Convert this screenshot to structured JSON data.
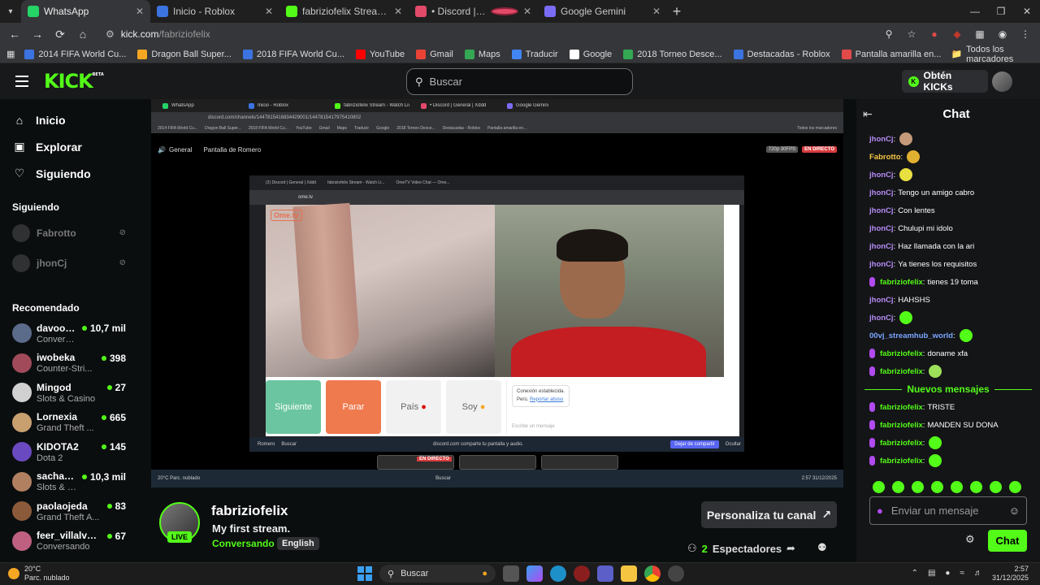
{
  "browser": {
    "tabs": [
      {
        "title": "WhatsApp",
        "fav_color": "#25d366",
        "active": true
      },
      {
        "title": "Inicio - Roblox",
        "fav_color": "#3b73e0",
        "active": false
      },
      {
        "title": "fabriziofelix Stream - Watch Live",
        "fav_color": "#53fc18",
        "active": false
      },
      {
        "title": "• Discord | General | Xddd",
        "fav_color": "#e24a6a",
        "active": false
      },
      {
        "title": "Google Gemini",
        "fav_color": "#7b6cf6",
        "active": false
      }
    ],
    "url_host": "kick.com",
    "url_path": "/fabriziofelix",
    "bookmarks": [
      {
        "label": "2014 FIFA World Cu...",
        "color": "#3b73e0"
      },
      {
        "label": "Dragon Ball Super...",
        "color": "#f5a623"
      },
      {
        "label": "2018 FIFA World Cu...",
        "color": "#3b73e0"
      },
      {
        "label": "YouTube",
        "color": "#ff0000"
      },
      {
        "label": "Gmail",
        "color": "#ea4335"
      },
      {
        "label": "Maps",
        "color": "#34a853"
      },
      {
        "label": "Traducir",
        "color": "#4285f4"
      },
      {
        "label": "Google",
        "color": "#ffffff"
      },
      {
        "label": "2018 Torneo Desce...",
        "color": "#34a853"
      },
      {
        "label": "Destacadas - Roblox",
        "color": "#3b73e0"
      },
      {
        "label": "Pantalla amarilla en...",
        "color": "#e24a4a"
      }
    ],
    "all_bookmarks": "Todos los marcadores"
  },
  "kick": {
    "logo": "KICK",
    "logo_badge": "BETA",
    "search_placeholder": "Buscar",
    "get_kicks": "Obtén KICKs",
    "nav": [
      {
        "label": "Inicio",
        "icon": "home-icon"
      },
      {
        "label": "Explorar",
        "icon": "compass-icon"
      },
      {
        "label": "Siguiendo",
        "icon": "heart-icon"
      }
    ],
    "following_header": "Siguiendo",
    "following": [
      {
        "name": "Fabrotto"
      },
      {
        "name": "jhonCj"
      }
    ],
    "recommended_header": "Recomendado",
    "recommended": [
      {
        "name": "davoox...",
        "category": "Convers...",
        "viewers": "10,7 mil",
        "color": "#5b6b8a"
      },
      {
        "name": "iwobeka",
        "category": "Counter-Stri...",
        "viewers": "398",
        "color": "#a04a5a"
      },
      {
        "name": "Mingod",
        "category": "Slots & Casino",
        "viewers": "27",
        "color": "#d0d0d0"
      },
      {
        "name": "Lornexia",
        "category": "Grand Theft ...",
        "viewers": "665",
        "color": "#c8a070"
      },
      {
        "name": "KIDOTA2",
        "category": "Dota 2",
        "viewers": "145",
        "color": "#6a4ac0"
      },
      {
        "name": "sachau...",
        "category": "Slots & C...",
        "viewers": "10,3 mil",
        "color": "#b08060"
      },
      {
        "name": "paolaojeda",
        "category": "Grand Theft A...",
        "viewers": "83",
        "color": "#8a5a3a"
      },
      {
        "name": "feer_villalvaxo",
        "category": "Conversando",
        "viewers": "67",
        "color": "#c06080"
      }
    ],
    "stream": {
      "channel": "fabriziofelix",
      "title": "My first stream.",
      "category": "Conversando",
      "language": "English",
      "live": "LIVE",
      "customize": "Personaliza tu canal",
      "viewers_count": "2",
      "viewers_label": "Espectadores"
    },
    "chat": {
      "title": "Chat",
      "messages": [
        {
          "user": "jhonCj",
          "color": "#b48cf5",
          "text": "",
          "emote": "#c49a7a",
          "badge": false
        },
        {
          "user": "Fabrotto",
          "color": "#f5c542",
          "text": "",
          "emote": "#e0b030",
          "badge": false
        },
        {
          "user": "jhonCj",
          "color": "#b48cf5",
          "text": "",
          "emote": "#e8e040",
          "badge": false
        },
        {
          "user": "jhonCj",
          "color": "#b48cf5",
          "text": "Tengo un amigo cabro",
          "emote": "",
          "badge": false
        },
        {
          "user": "jhonCj",
          "color": "#b48cf5",
          "text": "Con lentes",
          "emote": "",
          "badge": false
        },
        {
          "user": "jhonCj",
          "color": "#b48cf5",
          "text": "Chulupi mi idolo",
          "emote": "",
          "badge": false
        },
        {
          "user": "jhonCj",
          "color": "#b48cf5",
          "text": "Haz llamada con la ari",
          "emote": "",
          "badge": false
        },
        {
          "user": "jhonCj",
          "color": "#b48cf5",
          "text": "Ya tienes los requisitos",
          "emote": "",
          "badge": false
        },
        {
          "user": "fabriziofelix",
          "color": "#53fc18",
          "text": "tienes 19 toma",
          "emote": "",
          "badge": true
        },
        {
          "user": "jhonCj",
          "color": "#b48cf5",
          "text": "HAHSHS",
          "emote": "",
          "badge": false
        },
        {
          "user": "jhonCj",
          "color": "#b48cf5",
          "text": "",
          "emote": "#53fc18",
          "badge": false
        },
        {
          "user": "00vj_streamhub_world",
          "color": "#7aa6ff",
          "text": "",
          "emote": "#53fc18",
          "badge": false
        },
        {
          "user": "fabriziofelix",
          "color": "#53fc18",
          "text": "doname xfa",
          "emote": "",
          "badge": true
        },
        {
          "user": "fabriziofelix",
          "color": "#53fc18",
          "text": "",
          "emote": "#9de05a",
          "badge": true
        }
      ],
      "new_messages": "Nuevos mensajes",
      "messages_after": [
        {
          "user": "fabriziofelix",
          "color": "#53fc18",
          "text": "TRISTE",
          "emote": "",
          "badge": true
        },
        {
          "user": "fabriziofelix",
          "color": "#53fc18",
          "text": "MANDEN SU DONA",
          "emote": "",
          "badge": true
        },
        {
          "user": "fabriziofelix",
          "color": "#53fc18",
          "text": "",
          "emote": "#53fc18",
          "badge": true
        },
        {
          "user": "fabriziofelix",
          "color": "#53fc18",
          "text": "",
          "emote": "#53fc18",
          "badge": true
        }
      ],
      "input_placeholder": "Enviar un mensaje",
      "send": "Chat"
    }
  },
  "screen_share": {
    "tabs": [
      "WhatsApp",
      "Inicio - Roblox",
      "fabriziofelix Stream - Watch Live",
      "• Discord | General | Xddd",
      "Google Gemini"
    ],
    "url": "discord.com/channels/1447815416834429001/1447815417975410802",
    "bookmarks": [
      "2014 FIFA World Cu...",
      "Dragon Ball Super...",
      "2018 FIFA World Cu...",
      "YouTube",
      "Gmail",
      "Maps",
      "Traducir",
      "Google",
      "2018 Torneo Desce...",
      "Destacadas - Roblox",
      "Pantalla amarilla en..."
    ],
    "all_bookmarks": "Todos los marcadores",
    "channel": "General",
    "sharing_label": "Pantalla de Romero",
    "quality": "720p 30FPS",
    "live": "EN DIRECTO",
    "ome": {
      "tabs": [
        "(2) Discord | General | Xddd",
        "fabriziofelix Stream - Watch Li...",
        "OmeTV Video Chat — Ome..."
      ],
      "url": "ome.tv",
      "logo": "Ome.tv",
      "buttons": [
        "Siguiente",
        "Parar",
        "País",
        "Soy"
      ],
      "connection": "Conexión establecida.",
      "country": "Perú.",
      "report": "Reportar abuso",
      "input": "Escribe un mensaje",
      "sharing_bar": "discord.com comparte tu pantalla y audio.",
      "stop_share": "Dejar de compartir",
      "hide": "Ocultar",
      "user": "Romero",
      "search": "Buscar"
    },
    "taskbar": {
      "temp": "20°C",
      "weather": "Parc. nublado",
      "search": "Buscar",
      "time": "2:57",
      "date": "31/12/2025"
    }
  },
  "taskbar": {
    "temp": "20°C",
    "weather": "Parc. nublado",
    "search": "Buscar",
    "time": "2:57",
    "date": "31/12/2025"
  }
}
